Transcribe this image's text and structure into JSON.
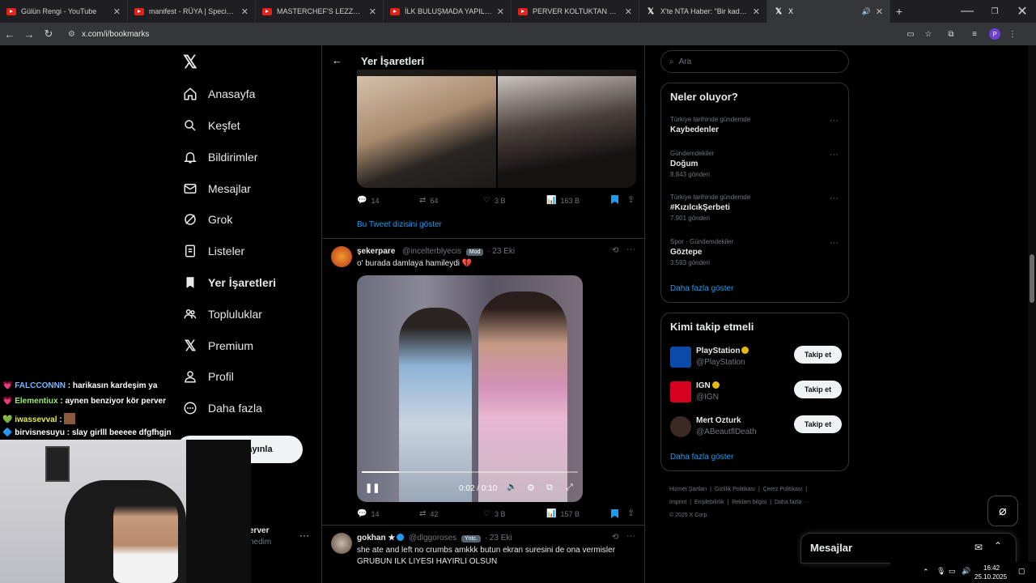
{
  "browser": {
    "tabs": [
      {
        "label": "Gülün Rengi - YouTube",
        "icon": "youtube-icon"
      },
      {
        "label": "manifest - RÜYA | Special Danc",
        "icon": "youtube-icon"
      },
      {
        "label": "MASTERCHEF'S LEZZO - YouTu",
        "icon": "youtube-icon"
      },
      {
        "label": "İLK BULUŞMADA YAPILMAMAS",
        "icon": "youtube-icon"
      },
      {
        "label": "PERVER KOLTUKTAN DÜŞÜYOR",
        "icon": "youtube-icon"
      },
      {
        "label": "X'te NTA Haber: \"Bir kadın kap",
        "icon": "x-icon"
      },
      {
        "label": "X",
        "icon": "x-icon"
      }
    ],
    "url": "x.com/i/bookmarks",
    "profile_initial": "P"
  },
  "sidebar": {
    "items": [
      {
        "label": "Anasayfa",
        "icon": "home-icon"
      },
      {
        "label": "Keşfet",
        "icon": "search-icon"
      },
      {
        "label": "Bildirimler",
        "icon": "bell-icon"
      },
      {
        "label": "Mesajlar",
        "icon": "mail-icon"
      },
      {
        "label": "Grok",
        "icon": "grok-icon"
      },
      {
        "label": "Listeler",
        "icon": "list-icon"
      },
      {
        "label": "Yer İşaretleri",
        "icon": "bookmark-icon"
      },
      {
        "label": "Topluluklar",
        "icon": "communities-icon"
      },
      {
        "label": "Premium",
        "icon": "x-icon"
      },
      {
        "label": "Profil",
        "icon": "profile-icon"
      },
      {
        "label": "Daha fazla",
        "icon": "more-circle-icon"
      }
    ],
    "post_button_partial": "ayınla",
    "account_name_partial": "erver",
    "account_handle_partial": "nedim"
  },
  "feed": {
    "title": "Yer İşaretleri",
    "tweet1": {
      "replies": "14",
      "retweets": "64",
      "likes": "3 B",
      "views": "163 B",
      "show_thread": "Bu Tweet dizisini göster"
    },
    "tweet2": {
      "name": "şekerpare",
      "handle": "@incelterblyecis",
      "badge": "Mod",
      "date": "· 23 Eki",
      "text": "o' burada damlaya hamileydi 💔",
      "video_time": "0:02 / 0:10",
      "replies": "14",
      "retweets": "42",
      "likes": "3 B",
      "views": "157 B"
    },
    "tweet3": {
      "name": "gokhan ★",
      "handle": "@dlggoroses",
      "badge": "Yntc.",
      "date": "· 23 Eki",
      "text": "she ate and left no crumbs amkkk butun ekran suresini de ona vermisler",
      "text2": "GRUBUN ILK LIYESI HAYIRLI OLSUN"
    }
  },
  "right": {
    "search_placeholder": "Ara",
    "trends_title": "Neler oluyor?",
    "trends": [
      {
        "category": "Türkiye tarihinde gündemde",
        "name": "Kaybedenler",
        "count": ""
      },
      {
        "category": "Gündemdekiler",
        "name": "Doğum",
        "count": "8.843 gönderi"
      },
      {
        "category": "Türkiye tarihinde gündemde",
        "name": "#KızılcıkŞerbeti",
        "count": "7.901 gönderi"
      },
      {
        "category": "Spor · Gündemdekiler",
        "name": "Göztepe",
        "count": "3.593 gönderi"
      }
    ],
    "trends_more": "Daha fazla göster",
    "follow_title": "Kimi takip etmeli",
    "follow": [
      {
        "name": "PlayStation",
        "handle": "@PlayStation",
        "button": "Takip et",
        "color": "#0b4aa8"
      },
      {
        "name": "IGN",
        "handle": "@IGN",
        "button": "Takip et",
        "color": "#d7001f"
      },
      {
        "name": "Mert Ozturk",
        "handle": "@ABeautflDeath",
        "button": "Takip et",
        "color": "#3b2a24"
      }
    ],
    "follow_more": "Daha fazla göster",
    "footer": [
      "Hizmet Şartları",
      "Gizlilik Politikası",
      "Çerez Politikası",
      "Imprint",
      "Erişilebilirlik",
      "Reklam bilgisi",
      "Daha fazla ···",
      "© 2025 X Corp."
    ],
    "messages_title": "Mesajlar"
  },
  "stream_chat": [
    {
      "user": "FALCCONNN",
      "msg": ": harikasın kardeşim ya"
    },
    {
      "user": "Elementiux",
      "msg": ": aynen benziyor kör perver"
    },
    {
      "user": "iwassevval",
      "msg": ":"
    },
    {
      "user": "birvisnesuyu",
      "msg": ": slay girlll beeeee dfgfhgjn"
    }
  ],
  "taskbar": {
    "time": "16:42",
    "date": "25.10.2025"
  },
  "colors": {
    "accent": "#1d9bf0",
    "bg": "#000000",
    "border": "#2f3336",
    "muted": "#71767b"
  }
}
